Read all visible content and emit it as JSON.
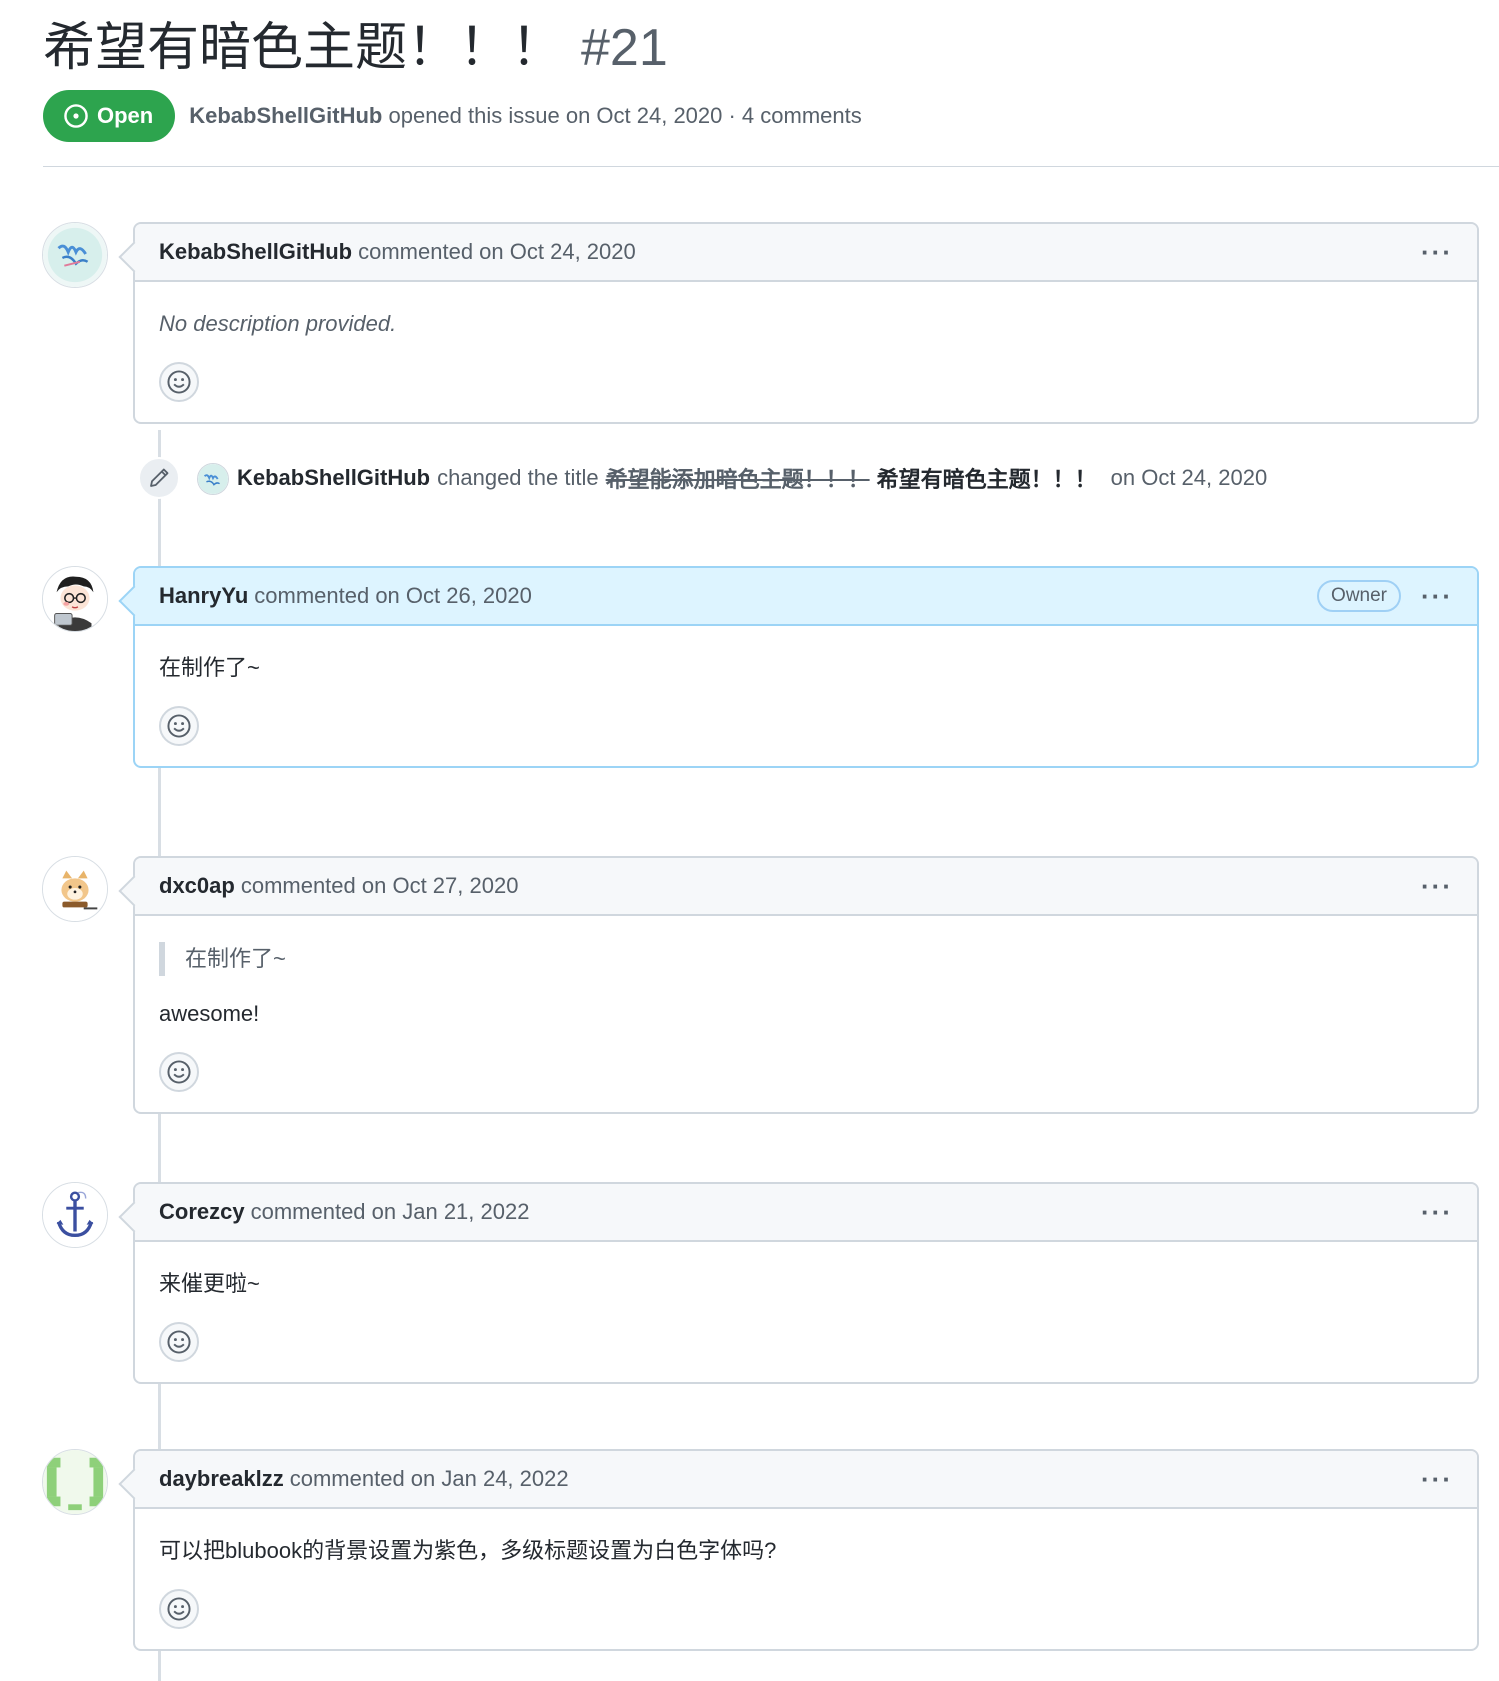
{
  "issue": {
    "title": "希望有暗色主题！！！",
    "number": "#21",
    "state": "Open",
    "author": "KebabShellGitHub",
    "opened_text": "opened this issue on Oct 24, 2020 · 4 comments"
  },
  "comments": [
    {
      "author": "KebabShellGitHub",
      "action": "commented on Oct 24, 2020",
      "body": "No description provided.",
      "menu": "···"
    },
    {
      "author": "HanryYu",
      "action": "commented on Oct 26, 2020",
      "badge": "Owner",
      "body": "在制作了~",
      "menu": "···"
    },
    {
      "author": "dxc0ap",
      "action": "commented on Oct 27, 2020",
      "quote": "在制作了~",
      "body": "awesome!",
      "menu": "···"
    },
    {
      "author": "Corezcy",
      "action": "commented on Jan 21, 2022",
      "body": "来催更啦~",
      "menu": "···"
    },
    {
      "author": "daybreaklzz",
      "action": "commented on Jan 24, 2022",
      "body": "可以把blubook的背景设置为紫色，多级标题设置为白色字体吗?",
      "menu": "···"
    }
  ],
  "event": {
    "author": "KebabShellGitHub",
    "action": "changed the title",
    "old_title": "希望能添加暗色主题！！！",
    "new_title": "希望有暗色主题！！！",
    "date": "on Oct 24, 2020"
  },
  "colors": {
    "open_green": "#2da44e",
    "owner_header": "#ddf4ff",
    "border": "#d0d7de"
  },
  "icons": {
    "state": "issue-opened-icon",
    "event": "pencil-icon",
    "reaction": "smiley-icon",
    "menu": "kebab-horizontal-icon"
  }
}
